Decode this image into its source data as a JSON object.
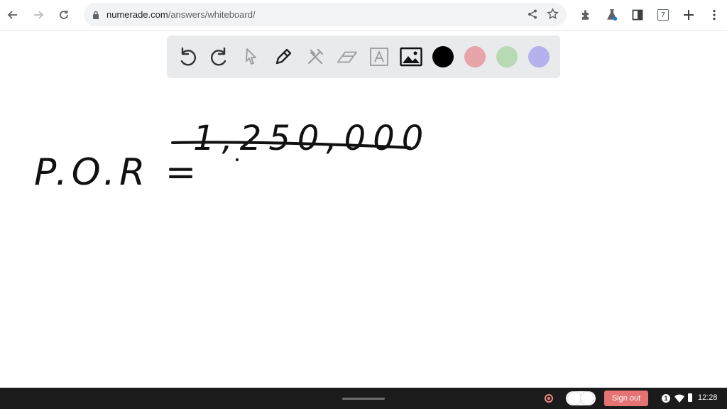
{
  "browser": {
    "url_host": "numerade.com",
    "url_path": "/answers/whiteboard/",
    "tab_count": "7"
  },
  "whiteboard": {
    "tools": [
      "undo",
      "redo",
      "select",
      "pen",
      "tools",
      "eraser",
      "text",
      "image"
    ],
    "colors": [
      "#000000",
      "#e8a4ab",
      "#b7d9b4",
      "#b4b2ec"
    ],
    "selected_color": "#000000",
    "handwriting": {
      "lhs": "P.O.R =",
      "numerator": "1,250,000"
    }
  },
  "shelf": {
    "sign_out_label": "Sign out",
    "notification_count": "1",
    "time": "12:28"
  }
}
